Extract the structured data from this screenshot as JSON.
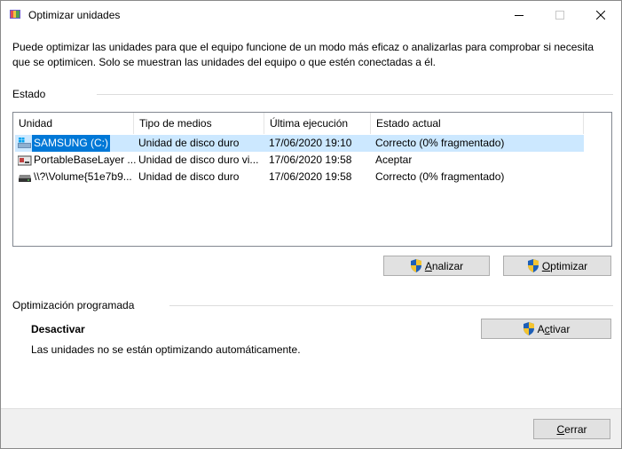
{
  "window": {
    "title": "Optimizar unidades"
  },
  "description": "Puede optimizar las unidades para que el equipo funcione de un modo más eficaz o analizarlas para comprobar si necesita que se optimicen. Solo se muestran las unidades del equipo o que estén conectadas a él.",
  "status_group": {
    "label": "Estado"
  },
  "drives": {
    "columns": [
      "Unidad",
      "Tipo de medios",
      "Última ejecución",
      "Estado actual"
    ],
    "rows": [
      {
        "unit": "SAMSUNG (C:)",
        "media": "Unidad de disco duro",
        "last_run": "17/06/2020 19:10",
        "status": "Correcto (0% fragmentado)",
        "selected": true,
        "icon": "system-drive-icon"
      },
      {
        "unit": "PortableBaseLayer ...",
        "media": "Unidad de disco duro vi...",
        "last_run": "17/06/2020 19:58",
        "status": "Aceptar",
        "selected": false,
        "icon": "virtual-drive-icon"
      },
      {
        "unit": "\\\\?\\Volume{51e7b9...",
        "media": "Unidad de disco duro",
        "last_run": "17/06/2020 19:58",
        "status": "Correcto (0% fragmentado)",
        "selected": false,
        "icon": "hard-drive-icon"
      }
    ]
  },
  "buttons": {
    "analyze_accel": "A",
    "analyze_rest": "nalizar",
    "optimize_accel": "O",
    "optimize_rest": "ptimizar",
    "activate_pre": "A",
    "activate_accel": "c",
    "activate_rest": "tivar",
    "close_accel": "C",
    "close_rest": "errar"
  },
  "schedule_group": {
    "label": "Optimización programada",
    "state": "Desactivar",
    "detail": "Las unidades no se están optimizando automáticamente."
  },
  "colors": {
    "selection": "#0078d7",
    "row_highlight": "#cce8ff",
    "button_face": "#e1e1e1",
    "footer": "#f0f0f0"
  }
}
